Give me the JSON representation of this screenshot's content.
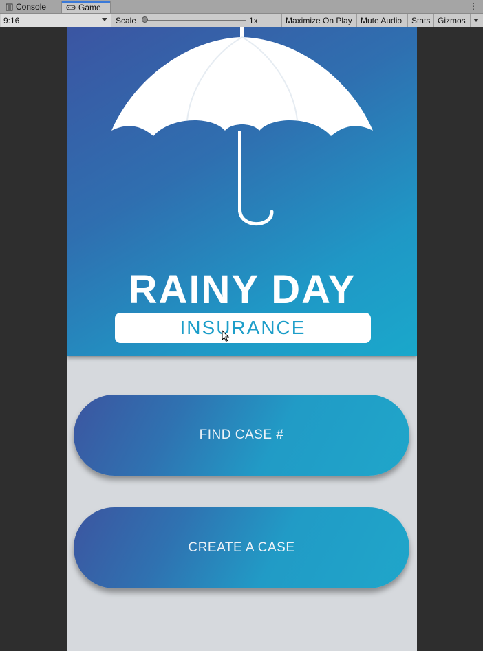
{
  "editor": {
    "tabs": [
      {
        "label": "Console",
        "icon": "console-icon"
      },
      {
        "label": "Game",
        "icon": "gamepad-icon"
      }
    ],
    "menu_icon": "kebab-menu-icon"
  },
  "toolbar": {
    "aspect": "9:16",
    "scale_label": "Scale",
    "scale_value": "1x",
    "maximize_on_play": "Maximize On Play",
    "mute_audio": "Mute Audio",
    "stats": "Stats",
    "gizmos": "Gizmos"
  },
  "app": {
    "logo_title": "RAINY DAY",
    "logo_subtitle": "INSURANCE",
    "buttons": {
      "find_case": "FIND CASE #",
      "create_case": "CREATE A CASE"
    },
    "colors": {
      "gradient_start": "#3b55a2",
      "gradient_end": "#1aa8cb",
      "background": "#d6d9dd",
      "subtitle": "#1d9ec9"
    }
  }
}
